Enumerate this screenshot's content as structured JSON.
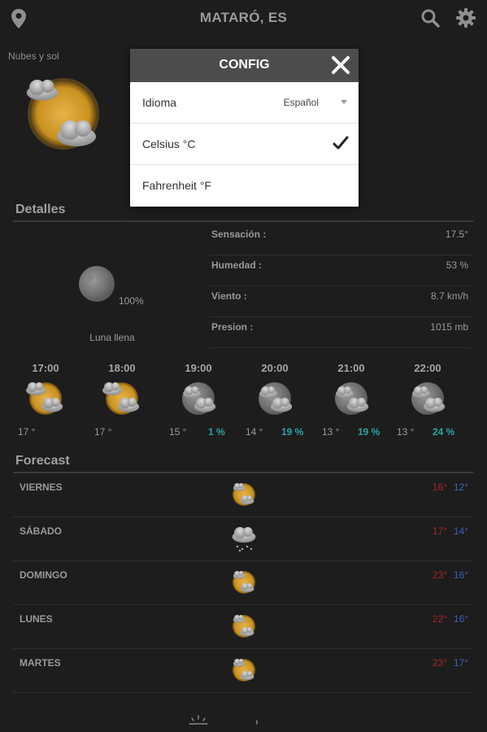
{
  "header": {
    "title": "MATARÓ, ES",
    "location_icon": "location-pin-icon",
    "search_icon": "search-icon",
    "settings_icon": "gear-icon"
  },
  "current": {
    "condition": "Nubes y sol",
    "icon": "sun-clouds-icon"
  },
  "details": {
    "heading": "Detalles",
    "moon": {
      "percent": "100%",
      "phase": "Luna llena",
      "icon": "full-moon-icon"
    },
    "rows": [
      {
        "label": "Sensación :",
        "value": "17.5°"
      },
      {
        "label": "Humedad :",
        "value": "53 %"
      },
      {
        "label": "Viento :",
        "value": "8.7 km/h"
      },
      {
        "label": "Presion :",
        "value": "1015 mb"
      }
    ]
  },
  "hourly": [
    {
      "time": "17:00",
      "temp": "17 °",
      "precip": "",
      "icon": "sun-clouds-icon"
    },
    {
      "time": "18:00",
      "temp": "17 °",
      "precip": "",
      "icon": "sun-clouds-icon"
    },
    {
      "time": "19:00",
      "temp": "15 °",
      "precip": "1 %",
      "icon": "moon-clouds-icon"
    },
    {
      "time": "20:00",
      "temp": "14 °",
      "precip": "19 %",
      "icon": "moon-clouds-icon"
    },
    {
      "time": "21:00",
      "temp": "13 °",
      "precip": "19 %",
      "icon": "moon-clouds-icon"
    },
    {
      "time": "22:00",
      "temp": "13 °",
      "precip": "24 %",
      "icon": "moon-clouds-icon"
    }
  ],
  "forecast": {
    "heading": "Forecast",
    "days": [
      {
        "day": "VIERNES",
        "hi": "16°",
        "lo": "12°",
        "icon": "sun-clouds-icon"
      },
      {
        "day": "SÁBADO",
        "hi": "17°",
        "lo": "14°",
        "icon": "rain-cloud-icon"
      },
      {
        "day": "DOMINGO",
        "hi": "23°",
        "lo": "16°",
        "icon": "sun-clouds-icon"
      },
      {
        "day": "LUNES",
        "hi": "22°",
        "lo": "16°",
        "icon": "sun-clouds-icon"
      },
      {
        "day": "MARTES",
        "hi": "23°",
        "lo": "17°",
        "icon": "sun-clouds-icon"
      }
    ]
  },
  "config": {
    "title": "CONFIG",
    "language_label": "Idioma",
    "language_value": "Español",
    "celsius_label": "Celsius °C",
    "fahrenheit_label": "Fahrenheit °F",
    "selected_unit": "celsius"
  },
  "colors": {
    "background": "#1d1d1d",
    "high_temp": "#a52424",
    "low_temp": "#3b63b0",
    "precip": "#2aa5a5",
    "dialog_header": "#4c4c4c"
  }
}
